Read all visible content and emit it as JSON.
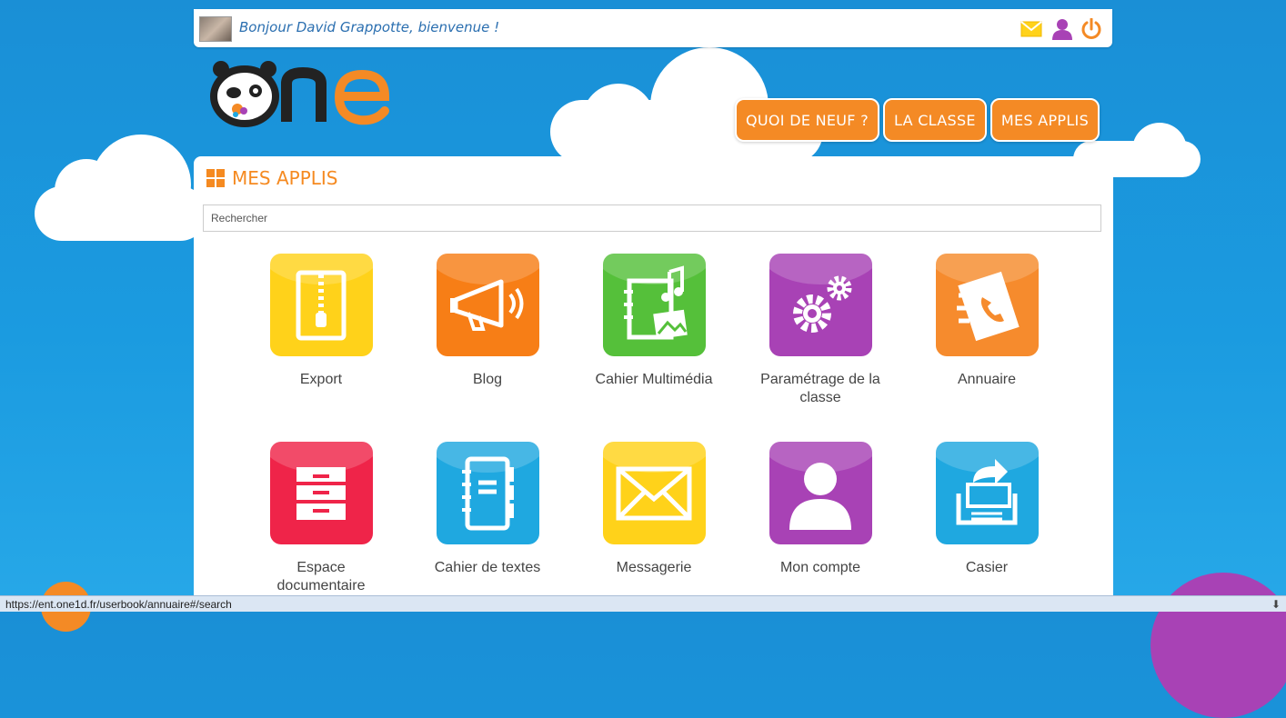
{
  "topbar": {
    "welcome": "Bonjour David Grappotte, bienvenue !",
    "icons": [
      "mail-icon",
      "user-icon",
      "power-icon"
    ]
  },
  "logo": {
    "text": "One"
  },
  "nav": [
    {
      "label": "QUOI DE NEUF ?"
    },
    {
      "label": "LA CLASSE"
    },
    {
      "label": "MES APPLIS"
    }
  ],
  "page": {
    "title": "MES APPLIS"
  },
  "search": {
    "placeholder": "Rechercher",
    "value": ""
  },
  "apps": [
    {
      "label": "Export",
      "color": "#ffd21a",
      "icon": "zip-file-icon"
    },
    {
      "label": "Blog",
      "color": "#f77e16",
      "icon": "megaphone-icon"
    },
    {
      "label": "Cahier Multimédia",
      "color": "#55c03a",
      "icon": "multimedia-notebook-icon"
    },
    {
      "label": "Paramétrage de la classe",
      "color": "#a842b5",
      "icon": "gears-icon"
    },
    {
      "label": "Annuaire",
      "color": "#f68b2d",
      "icon": "phone-book-icon"
    },
    {
      "label": "Espace documentaire",
      "color": "#ef2449",
      "icon": "filing-cabinet-icon"
    },
    {
      "label": "Cahier de textes",
      "color": "#1fa8e0",
      "icon": "notebook-icon"
    },
    {
      "label": "Messagerie",
      "color": "#ffd21a",
      "icon": "envelope-icon"
    },
    {
      "label": "Mon compte",
      "color": "#a842b5",
      "icon": "user-account-icon"
    },
    {
      "label": "Casier",
      "color": "#1fa8e0",
      "icon": "tray-icon"
    }
  ],
  "status": {
    "url": "https://ent.one1d.fr/userbook/annuaire#/search"
  }
}
